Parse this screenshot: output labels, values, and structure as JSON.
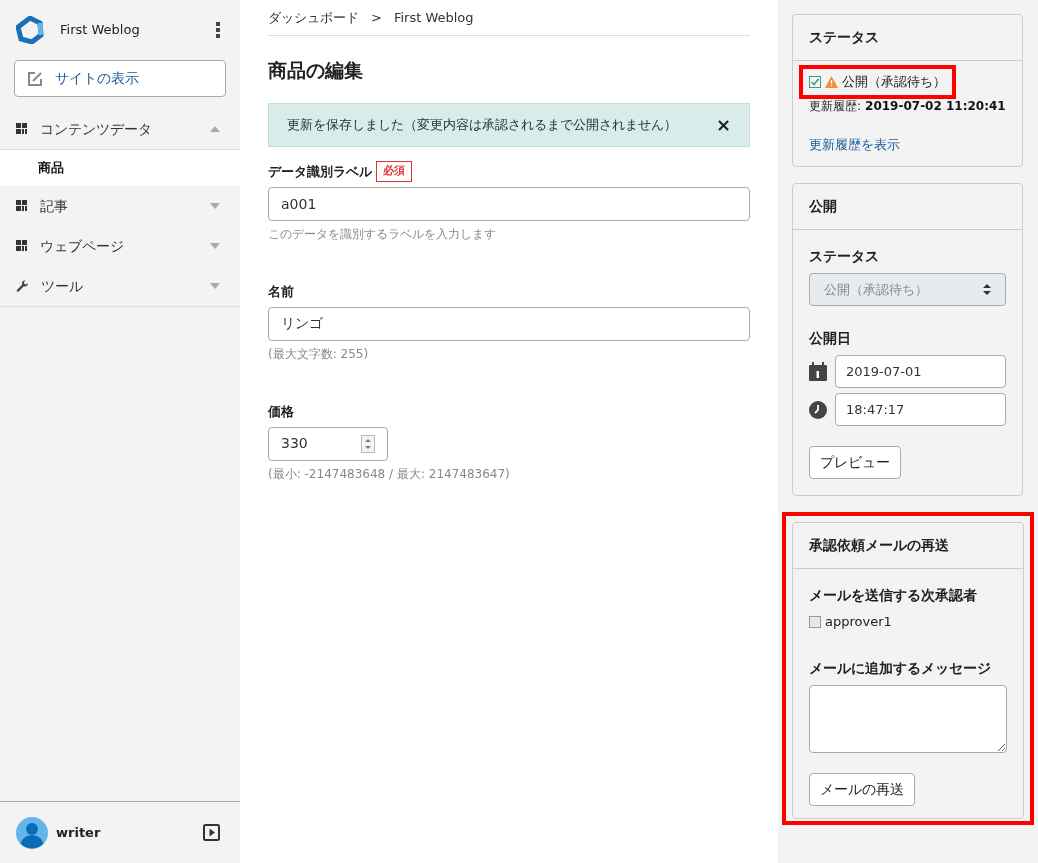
{
  "sidebar": {
    "site_name": "First Weblog",
    "view_site_button": "サイトの表示",
    "nav": [
      {
        "label": "コンテンツデータ",
        "kind": "grid",
        "expanded": true,
        "children": [
          {
            "label": "商品",
            "selected": true
          }
        ]
      },
      {
        "label": "記事",
        "kind": "grid",
        "expanded": false
      },
      {
        "label": "ウェブページ",
        "kind": "grid",
        "expanded": false
      },
      {
        "label": "ツール",
        "kind": "tool",
        "expanded": false
      }
    ],
    "user": {
      "name": "writer"
    }
  },
  "breadcrumb": [
    "ダッシュボード",
    ">",
    "First Weblog"
  ],
  "page_title": "商品の編集",
  "alert": {
    "message": "更新を保存しました（変更内容は承認されるまで公開されません）",
    "close": "×"
  },
  "fields": [
    {
      "kind": "text",
      "label": "データ識別ラベル",
      "required_badge": "必須",
      "value": "a001",
      "hint": "このデータを識別するラベルを入力します"
    },
    {
      "kind": "text",
      "label": "名前",
      "value": "リンゴ",
      "hint": "(最大文字数: 255)"
    },
    {
      "kind": "number",
      "label": "価格",
      "value": "330",
      "hint": "(最小: -2147483648 / 最大: 2147483647)"
    }
  ],
  "status_panel": {
    "title": "ステータス",
    "status": "公開（承認待ち）",
    "highlighted": true,
    "history_label": "更新履歴:",
    "history_value": "2019-07-02 11:20:41",
    "history_link": "更新履歴を表示"
  },
  "publish_panel": {
    "title": "公開",
    "status_label": "ステータス",
    "status_select": "公開（承認待ち）",
    "date_label": "公開日",
    "date": "2019-07-01",
    "time": "18:47:17",
    "preview_button": "プレビュー"
  },
  "resend_panel": {
    "title": "承認依頼メールの再送",
    "highlighted": true,
    "approvers_label": "メールを送信する次承認者",
    "approvers": [
      {
        "name": "approver1",
        "checked": false
      }
    ],
    "message_label": "メールに追加するメッセージ",
    "resend_button": "メールの再送"
  }
}
